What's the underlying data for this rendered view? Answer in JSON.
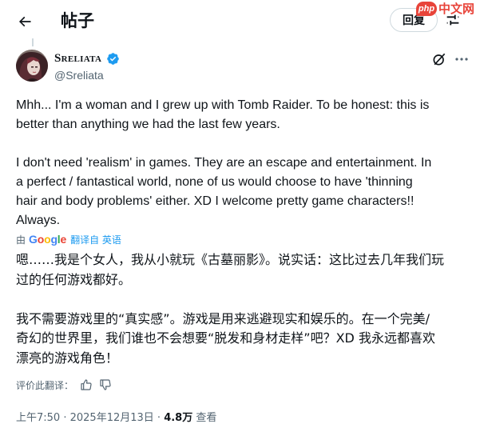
{
  "header": {
    "title": "帖子",
    "reply_label": "回复",
    "back_icon": "arrow-left-icon",
    "tune_icon": "sliders-icon"
  },
  "watermark": {
    "php": "php",
    "site": "中文网"
  },
  "author": {
    "display_name": "Sreliata",
    "handle": "@Sreliata",
    "verified": true,
    "verified_color": "#1d9bf0"
  },
  "post": {
    "text": "Mhh... I'm a woman and I grew up with Tomb Raider. To be honest: this is\nbetter than anything we had the last few years.\n\nI don't need 'realism' in games. They are an escape and entertainment. In\na perfect / fantastical world, none of us would choose to have 'thinning\nhair and body problems' either. XD I welcome pretty game characters!!\nAlways."
  },
  "translation": {
    "by_label": "由",
    "provider": "Google",
    "from_label": "翻译自 英语",
    "text": "嗯……我是个女人，我从小就玩《古墓丽影》。说实话：这比过去几年我们玩\n过的任何游戏都好。\n\n我不需要游戏里的“真实感”。游戏是用来逃避现实和娱乐的。在一个完美/\n奇幻的世界里，我们谁也不会想要“脱发和身材走样”吧？XD 我永远都喜欢\n漂亮的游戏角色！",
    "rate_label": "评价此翻译："
  },
  "meta": {
    "time": "上午7:50",
    "separator": " · ",
    "date": "2025年12月13日",
    "views": "4.8万",
    "views_label": "查看"
  },
  "colors": {
    "text": "#0f1419",
    "secondary": "#536471",
    "accent": "#1d9bf0",
    "border": "#cfd9de"
  }
}
